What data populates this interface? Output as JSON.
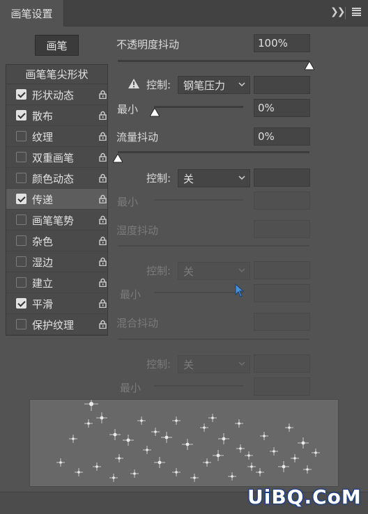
{
  "panel": {
    "tab_title": "画笔设置",
    "brush_button": "画笔"
  },
  "left_list": {
    "header": "画笔笔尖形状",
    "items": [
      {
        "label": "形状动态",
        "checked": true,
        "active": false
      },
      {
        "label": "散布",
        "checked": true,
        "active": false
      },
      {
        "label": "纹理",
        "checked": false,
        "active": false
      },
      {
        "label": "双重画笔",
        "checked": false,
        "active": false
      },
      {
        "label": "颜色动态",
        "checked": false,
        "active": false
      },
      {
        "label": "传递",
        "checked": true,
        "active": true
      },
      {
        "label": "画笔笔势",
        "checked": false,
        "active": false
      },
      {
        "label": "杂色",
        "checked": false,
        "active": false
      },
      {
        "label": "湿边",
        "checked": false,
        "active": false
      },
      {
        "label": "建立",
        "checked": false,
        "active": false
      },
      {
        "label": "平滑",
        "checked": true,
        "active": false
      },
      {
        "label": "保护纹理",
        "checked": false,
        "active": false
      }
    ]
  },
  "opacity_jitter": {
    "label": "不透明度抖动",
    "value": "100%",
    "slider_fraction": 1.0,
    "control_label": "控制:",
    "control_value": "钢笔压力",
    "control_value_field": "",
    "min_label": "最小",
    "min_value": "0%",
    "min_fraction": 0.0
  },
  "flow_jitter": {
    "label": "流量抖动",
    "value": "0%",
    "slider_fraction": 0.0,
    "control_label": "控制:",
    "control_value": "关",
    "control_value_field": "",
    "min_label": "最小",
    "min_value": ""
  },
  "wetness_jitter": {
    "label": "湿度抖动",
    "value": "",
    "control_label": "控制:",
    "control_value": "关",
    "control_value_field": "",
    "min_label": "最小",
    "min_value": ""
  },
  "mix_jitter": {
    "label": "混合抖动",
    "value": "",
    "control_label": "控制:",
    "control_value": "关",
    "control_value_field": "",
    "min_label": "最小",
    "min_value": ""
  },
  "watermark": "UiBQ.CoM",
  "colors": {
    "panel_bg": "#535353",
    "field_bg": "#454545",
    "text": "#d6d6d6",
    "disabled_text": "#7b7b7b"
  },
  "icons": {
    "collapse": "double-chevron-right-icon",
    "menu": "hamburger-menu-icon",
    "lock": "lock-icon",
    "warning": "warning-icon",
    "dropdown": "chevron-down-icon",
    "slider_thumb": "triangle-thumb-icon",
    "cursor": "mouse-pointer-icon"
  }
}
